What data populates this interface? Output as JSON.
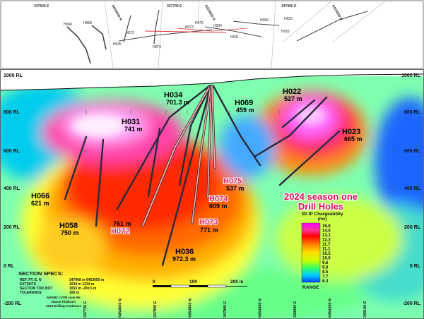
{
  "plan_view": {
    "grid_labels": [
      "347500 E",
      "347700 E",
      "347900 E",
      "6453600 N",
      "6453800 N",
      "6454000 N"
    ],
    "hole_labels": [
      "H066",
      "H058",
      "H036",
      "H072",
      "H074",
      "H073",
      "H075",
      "H034",
      "H031",
      "H069",
      "H022",
      "H023"
    ]
  },
  "section": {
    "rl_labels_left": [
      "1000 RL",
      "800 RL",
      "600 RL",
      "400 RL",
      "200 RL",
      "0 RL",
      "-200 RL"
    ],
    "rl_labels_right": [
      "1000 RL",
      "800 RL",
      "600 RL",
      "400 RL",
      "200 RL",
      "0 RL",
      "-200 RL"
    ],
    "bottom_axis_labels": [
      "347700 E",
      "6453600 N",
      "347800 E",
      "6453800 N",
      "347900 E",
      "6454000 N",
      "348000 E",
      "6454200 N",
      "348100 E"
    ],
    "holes_existing": [
      {
        "name": "H034",
        "depth": "701.3 m"
      },
      {
        "name": "H031",
        "depth": "741 m"
      },
      {
        "name": "H069",
        "depth": "459 m"
      },
      {
        "name": "H022",
        "depth": "527 m"
      },
      {
        "name": "H023",
        "depth": "665 m"
      },
      {
        "name": "H066",
        "depth": "621 m"
      },
      {
        "name": "H058",
        "depth": "750 m"
      },
      {
        "name": "H036",
        "depth": "972.3 m"
      }
    ],
    "holes_2024": [
      {
        "name": "H075",
        "depth": "537 m"
      },
      {
        "name": "H074",
        "depth": "609 m"
      },
      {
        "name": "H073",
        "depth": "771 m"
      },
      {
        "name": "H072",
        "depth": "761 m"
      }
    ],
    "title_line1": "2024 season one",
    "title_line2": "Drill Holes",
    "legend": {
      "title": "3D IP Chargeability",
      "unit": "(mv)",
      "values": [
        "16.8",
        "14.5",
        "13.1",
        "12.3",
        "11.7",
        "11.1",
        "10.5",
        "10.0",
        "9.6",
        "9.0",
        "8.5",
        "7.7",
        "6.3"
      ],
      "range_label": "RANGE",
      "colors": [
        "#ff00ff",
        "#ff3399",
        "#ff0000",
        "#ff4000",
        "#ff8000",
        "#ffb000",
        "#ffe000",
        "#ffff00",
        "#c8ff00",
        "#66ff33",
        "#00e0a0",
        "#00ccff",
        "#0066ff"
      ]
    },
    "scale": {
      "labels": [
        "0",
        "100",
        "200 m"
      ]
    },
    "section_specs": {
      "title": "SECTION SPECS:",
      "rows": [
        {
          "key": "REF. PT. E, N",
          "value": "347969 m   6453050 m"
        },
        {
          "key": "EXTENTS",
          "value": "1034 m   1334 m"
        },
        {
          "key": "SECTION TOP, BOT",
          "value": "1053 m   -290.5 m"
        },
        {
          "key": "TOLERANCE",
          "value": "105 m"
        }
      ],
      "footer": [
        "MAD83 / UTM zone 9N",
        "Nasco Platinum",
        "2024 Drilling Continues"
      ]
    }
  }
}
